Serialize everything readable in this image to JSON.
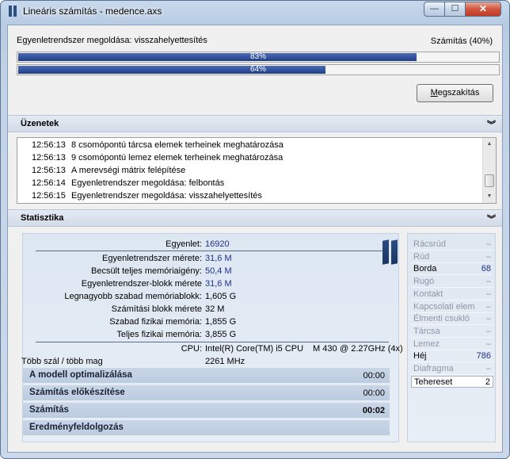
{
  "window": {
    "title": "Lineáris számítás - medence.axs",
    "minimize": "—",
    "maximize": "☐",
    "close": "✕"
  },
  "progress": {
    "status_text": "Egyenletrendszer megoldása: visszahelyettesítés",
    "overall_label": "Számítás (40%)",
    "bar1_percent_label": "83%",
    "bar1_value": 0.83,
    "bar2_percent_label": "64%",
    "bar2_value": 0.64,
    "cancel_label": "Megszakítás"
  },
  "messages": {
    "header": "Üzenetek",
    "items": [
      {
        "time": "12:56:13",
        "text": "8 csomópontú tárcsa elemek terheinek meghatározása"
      },
      {
        "time": "12:56:13",
        "text": "9 csomópontú lemez elemek terheinek meghatározása"
      },
      {
        "time": "12:56:13",
        "text": "A merevségi mátrix felépítése"
      },
      {
        "time": "12:56:14",
        "text": "Egyenletrendszer megoldása: felbontás"
      },
      {
        "time": "12:56:15",
        "text": "Egyenletrendszer megoldása: visszahelyettesítés"
      }
    ]
  },
  "statistics": {
    "header": "Statisztika",
    "rows": [
      {
        "label": "Egyenlet:",
        "value": "16920",
        "blue": true
      },
      {
        "label": "Egyenletrendszer mérete:",
        "value": "31,6 M",
        "blue": true
      },
      {
        "label": "Becsült teljes memóriaigény:",
        "value": "50,4 M",
        "blue": true
      },
      {
        "label": "Egyenletrendszer-blokk mérete",
        "value": "31,6 M",
        "blue": true
      },
      {
        "label": "Legnagyobb szabad memóriablokk:",
        "value": "1,605 G",
        "blue": false
      },
      {
        "label": "Számítási blokk mérete",
        "value": "32 M",
        "blue": false
      },
      {
        "label": "Szabad fizikai memória:",
        "value": "1,855 G",
        "blue": false
      },
      {
        "label": "Teljes fizikai memória:",
        "value": "3,855 G",
        "blue": false
      }
    ],
    "cpu_label": "CPU:",
    "cpu_value": "Intel(R) Core(TM) i5 CPU",
    "cpu_model": "M 430",
    "cpu_freq": "@ 2.27GHz (4x)",
    "threads_label": "Több szál / több mag",
    "threads_value": "2261 MHz",
    "phases": [
      {
        "label": "A modell optimalizálása",
        "time": "00:00",
        "bold": false
      },
      {
        "label": "Számítás előkészítése",
        "time": "00:00",
        "bold": false
      },
      {
        "label": "Számítás",
        "time": "00:02",
        "bold": true
      },
      {
        "label": "Eredményfeldolgozás",
        "time": "",
        "bold": false
      }
    ]
  },
  "elements": [
    {
      "name": "Rácsrúd",
      "value": "–",
      "active": false
    },
    {
      "name": "Rúd",
      "value": "–",
      "active": false
    },
    {
      "name": "Borda",
      "value": "68",
      "active": true
    },
    {
      "name": "Rugó",
      "value": "–",
      "active": false
    },
    {
      "name": "Kontakt",
      "value": "–",
      "active": false
    },
    {
      "name": "Kapcsolati elem",
      "value": "–",
      "active": false
    },
    {
      "name": "Élmenti csukló",
      "value": "–",
      "active": false
    },
    {
      "name": "Tárcsa",
      "value": "–",
      "active": false
    },
    {
      "name": "Lemez",
      "value": "–",
      "active": false
    },
    {
      "name": "Héj",
      "value": "786",
      "active": true
    },
    {
      "name": "Diafragma",
      "value": "–",
      "active": false
    },
    {
      "name": "Tehereset",
      "value": "2",
      "active": true
    }
  ],
  "colors": {
    "progress_fill": "#213f86",
    "value_blue": "#1e2f8c",
    "inactive_gray": "#8c97a8"
  }
}
